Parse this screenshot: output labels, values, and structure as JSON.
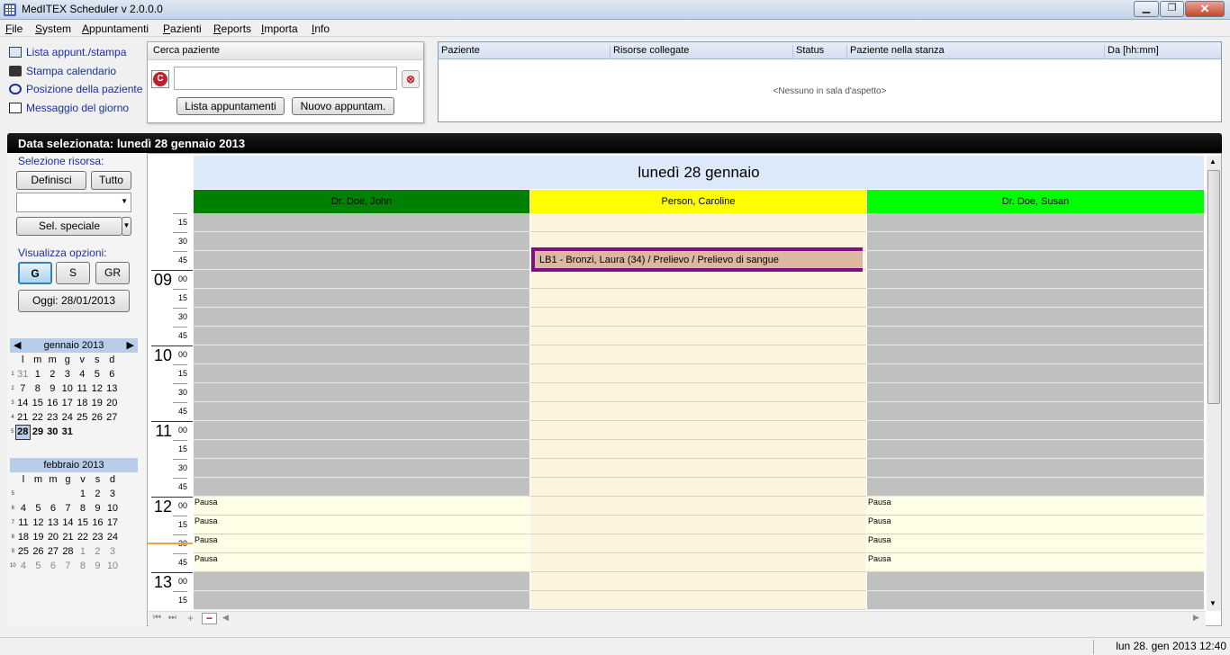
{
  "window": {
    "title": "MedITEX  Scheduler v 2.0.0.0"
  },
  "menu": [
    "File",
    "System",
    "Appuntamenti",
    "Pazienti",
    "Reports",
    "Importa",
    "Info"
  ],
  "quick_links": [
    "Lista appunt./stampa",
    "Stampa calendario",
    "Posizione della paziente",
    "Messaggio del giorno"
  ],
  "search": {
    "title": "Cerca paziente",
    "value": "",
    "btn_list": "Lista appuntamenti",
    "btn_new": "Nuovo appuntam."
  },
  "waiting_room": {
    "columns": [
      "Paziente",
      "Risorse collegate",
      "Status",
      "Paziente nella stanza",
      "Da [hh:mm]"
    ],
    "empty_text": "<Nessuno in sala d'aspetto>"
  },
  "date_bar": "Data selezionata: lunedì 28 gennaio 2013",
  "left": {
    "resource_label": "Selezione risorsa:",
    "btn_define": "Definisci",
    "btn_all": "Tutto",
    "btn_special": "Sel. speciale",
    "view_label": "Visualizza opzioni:",
    "view_g": "G",
    "view_s": "S",
    "view_gr": "GR",
    "today_btn": "Oggi: 28/01/2013"
  },
  "cal_jan": {
    "title": "gennaio 2013",
    "days": [
      "l",
      "m",
      "m",
      "g",
      "v",
      "s",
      "d"
    ],
    "weeks": [
      {
        "wk": "1",
        "d": [
          "31",
          "1",
          "2",
          "3",
          "4",
          "5",
          "6"
        ]
      },
      {
        "wk": "2",
        "d": [
          "7",
          "8",
          "9",
          "10",
          "11",
          "12",
          "13"
        ]
      },
      {
        "wk": "3",
        "d": [
          "14",
          "15",
          "16",
          "17",
          "18",
          "19",
          "20"
        ]
      },
      {
        "wk": "4",
        "d": [
          "21",
          "22",
          "23",
          "24",
          "25",
          "26",
          "27"
        ]
      },
      {
        "wk": "5",
        "d": [
          "28",
          "29",
          "30",
          "31",
          "",
          "",
          ""
        ]
      }
    ]
  },
  "cal_feb": {
    "title": "febbraio 2013",
    "days": [
      "l",
      "m",
      "m",
      "g",
      "v",
      "s",
      "d"
    ],
    "weeks": [
      {
        "wk": "5",
        "d": [
          "",
          "",
          "",
          "",
          "1",
          "2",
          "3"
        ]
      },
      {
        "wk": "6",
        "d": [
          "4",
          "5",
          "6",
          "7",
          "8",
          "9",
          "10"
        ]
      },
      {
        "wk": "7",
        "d": [
          "11",
          "12",
          "13",
          "14",
          "15",
          "16",
          "17"
        ]
      },
      {
        "wk": "8",
        "d": [
          "18",
          "19",
          "20",
          "21",
          "22",
          "23",
          "24"
        ]
      },
      {
        "wk": "9",
        "d": [
          "25",
          "26",
          "27",
          "28",
          "1",
          "2",
          "3"
        ]
      },
      {
        "wk": "10",
        "d": [
          "4",
          "5",
          "6",
          "7",
          "8",
          "9",
          "10"
        ]
      }
    ]
  },
  "schedule": {
    "day_title": "lunedì 28 gennaio",
    "resources": [
      {
        "name": "Dr. Doe, John",
        "color": "#008000"
      },
      {
        "name": "Person, Caroline",
        "color": "#ffff00"
      },
      {
        "name": "Dr. Doe, Susan",
        "color": "#00ff00"
      }
    ],
    "hours": [
      "09",
      "10",
      "11",
      "12",
      "13"
    ],
    "minute_marks": [
      "15",
      "30",
      "45",
      "00"
    ],
    "hour_sup": "00",
    "pause_label": "Pausa",
    "appointment": "LB1 - Bronzi, Laura (34) / Prelievo / Prelievo di sangue"
  },
  "status_clock": "lun 28. gen 2013 12:40"
}
